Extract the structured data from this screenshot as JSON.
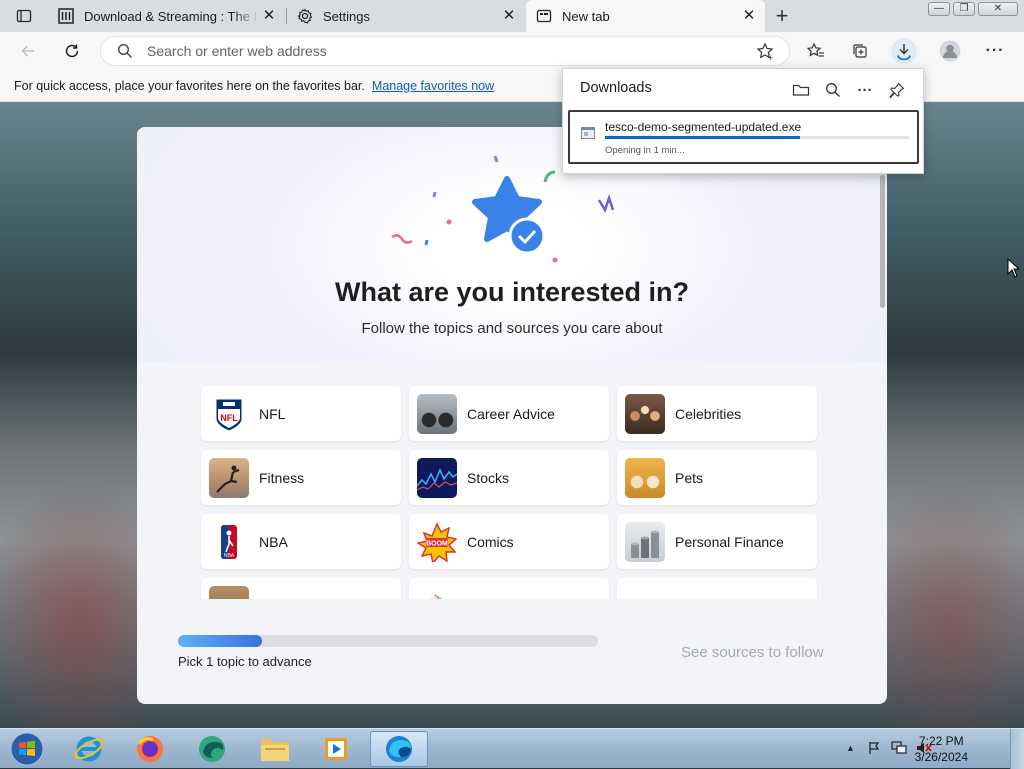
{
  "tabs": [
    {
      "title": "Download & Streaming : The Inte",
      "icon": "archive-icon"
    },
    {
      "title": "Settings",
      "icon": "gear-icon"
    },
    {
      "title": "New tab",
      "icon": "new-tab-icon"
    }
  ],
  "window_controls": {
    "minimize": "—",
    "restore": "❐",
    "close": "✕"
  },
  "address_bar": {
    "placeholder": "Search or enter web address",
    "value": ""
  },
  "favorites_bar": {
    "message": "For quick access, place your favorites here on the favorites bar.",
    "link": "Manage favorites now"
  },
  "page": {
    "title": "What are you interested in?",
    "subtitle": "Follow the topics and sources you care about",
    "topics": [
      {
        "label": "NFL",
        "icon": "nfl-logo"
      },
      {
        "label": "Career Advice",
        "icon": "career-advice-thumbnail"
      },
      {
        "label": "Celebrities",
        "icon": "celebrities-thumbnail"
      },
      {
        "label": "Fitness",
        "icon": "fitness-thumbnail"
      },
      {
        "label": "Stocks",
        "icon": "stocks-thumbnail"
      },
      {
        "label": "Pets",
        "icon": "pets-thumbnail"
      },
      {
        "label": "NBA",
        "icon": "nba-logo"
      },
      {
        "label": "Comics",
        "icon": "comics-thumbnail"
      },
      {
        "label": "Personal Finance",
        "icon": "personal-finance-thumbnail"
      }
    ],
    "progress": 0.2,
    "pick_text": "Pick 1 topic to advance",
    "see_sources": "See sources to follow"
  },
  "downloads": {
    "title": "Downloads",
    "file_name": "tesco-demo-segmented-updated.exe",
    "status": "Opening in 1 min...",
    "progress": 0.64
  },
  "taskbar": {
    "time": "7:22 PM",
    "date": "3/26/2024",
    "apps": [
      "start-button",
      "internet-explorer-icon",
      "firefox-icon",
      "edge-beta-icon",
      "file-explorer-icon",
      "media-player-icon",
      "edge-icon"
    ]
  },
  "colors": {
    "accent": "#0f6cbd",
    "progress_start": "#5fb0f7",
    "progress_end": "#3b6fe0",
    "link": "#0f5db4"
  }
}
